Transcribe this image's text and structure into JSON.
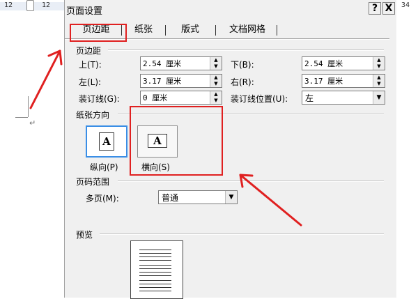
{
  "ruler": {
    "numbers": [
      "12",
      "12",
      "34"
    ]
  },
  "dialog": {
    "title": "页面设置",
    "help_button": "?",
    "close_button": "X",
    "tabs": [
      "页边距",
      "纸张",
      "版式",
      "文档网格"
    ],
    "margins": {
      "group_label": "页边距",
      "top_label": "上(T):",
      "top_value": "2.54 厘米",
      "bottom_label": "下(B):",
      "bottom_value": "2.54 厘米",
      "left_label": "左(L):",
      "left_value": "3.17 厘米",
      "right_label": "右(R):",
      "right_value": "3.17 厘米",
      "gutter_label": "装订线(G):",
      "gutter_value": "0 厘米",
      "gutter_pos_label": "装订线位置(U):",
      "gutter_pos_value": "左"
    },
    "orientation": {
      "group_label": "纸张方向",
      "portrait_label": "纵向(P)",
      "landscape_label": "横向(S)",
      "icon_letter": "A"
    },
    "pages": {
      "group_label": "页码范围",
      "multiple_label": "多页(M):",
      "multiple_value": "普通"
    },
    "preview": {
      "group_label": "预览"
    }
  },
  "colors": {
    "annotation": "#e02020",
    "selected_border": "#3a8ee6"
  }
}
